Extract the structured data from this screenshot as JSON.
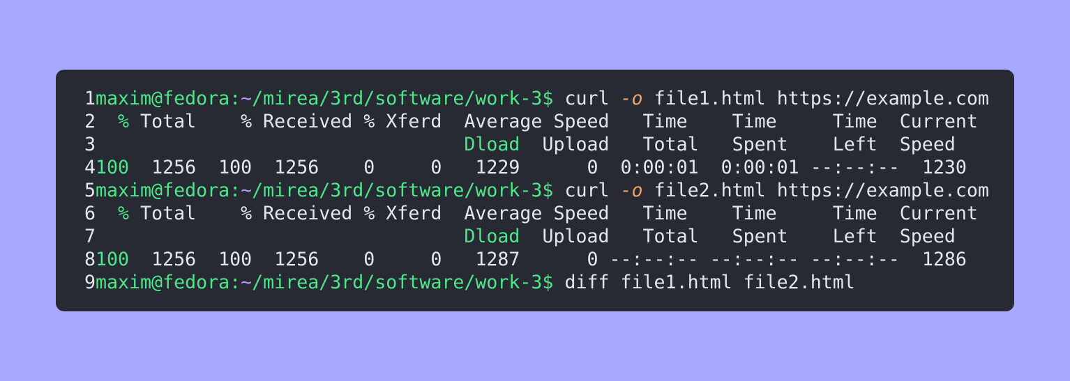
{
  "colors": {
    "background": "#a7a9fe",
    "terminal_bg": "#272a33",
    "text": "#e4e6ee",
    "green": "#4ee68a",
    "purple": "#b797f6",
    "orange": "#f4a15f"
  },
  "lines": [
    {
      "num": "1",
      "segments": [
        {
          "text": "maxim@fedora:",
          "color": "green"
        },
        {
          "text": "~",
          "color": "purple"
        },
        {
          "text": "/mirea/3rd/software/work-3$",
          "color": "green"
        },
        {
          "text": " curl ",
          "color": "text"
        },
        {
          "text": "-o",
          "color": "orange"
        },
        {
          "text": " file1.html https://example.com",
          "color": "text"
        }
      ]
    },
    {
      "num": "2",
      "segments": [
        {
          "text": "  ",
          "color": "text"
        },
        {
          "text": "%",
          "color": "green"
        },
        {
          "text": " Total    % Received % Xferd  Average Speed   Time    Time     Time  Current",
          "color": "text"
        }
      ]
    },
    {
      "num": "3",
      "segments": [
        {
          "text": "                                 ",
          "color": "text"
        },
        {
          "text": "Dload",
          "color": "green"
        },
        {
          "text": "  Upload   Total   Spent    Left  Speed",
          "color": "text"
        }
      ]
    },
    {
      "num": "4",
      "segments": [
        {
          "text": "100",
          "color": "green"
        },
        {
          "text": "  1256  100  1256    0     0   1229      0  0:00:01  0:00:01 --:--:--  1230",
          "color": "text"
        }
      ]
    },
    {
      "num": "5",
      "segments": [
        {
          "text": "maxim@fedora:",
          "color": "green"
        },
        {
          "text": "~",
          "color": "purple"
        },
        {
          "text": "/mirea/3rd/software/work-3$",
          "color": "green"
        },
        {
          "text": " curl ",
          "color": "text"
        },
        {
          "text": "-o",
          "color": "orange"
        },
        {
          "text": " file2.html https://example.com",
          "color": "text"
        }
      ]
    },
    {
      "num": "6",
      "segments": [
        {
          "text": "  ",
          "color": "text"
        },
        {
          "text": "%",
          "color": "green"
        },
        {
          "text": " Total    % Received % Xferd  Average Speed   Time    Time     Time  Current",
          "color": "text"
        }
      ]
    },
    {
      "num": "7",
      "segments": [
        {
          "text": "                                 ",
          "color": "text"
        },
        {
          "text": "Dload",
          "color": "green"
        },
        {
          "text": "  Upload   Total   Spent    Left  Speed",
          "color": "text"
        }
      ]
    },
    {
      "num": "8",
      "segments": [
        {
          "text": "100",
          "color": "green"
        },
        {
          "text": "  1256  100  1256    0     0   1287      0 --:--:-- --:--:-- --:--:--  1286",
          "color": "text"
        }
      ]
    },
    {
      "num": "9",
      "segments": [
        {
          "text": "maxim@fedora:",
          "color": "green"
        },
        {
          "text": "~",
          "color": "purple"
        },
        {
          "text": "/mirea/3rd/software/work-3$",
          "color": "green"
        },
        {
          "text": " diff file1.html file2.html",
          "color": "text"
        }
      ]
    }
  ]
}
